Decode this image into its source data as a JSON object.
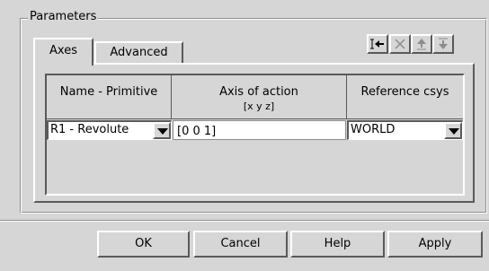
{
  "group": {
    "title": "Parameters"
  },
  "tabs": [
    {
      "label": "Axes",
      "active": true
    },
    {
      "label": "Advanced",
      "active": false
    }
  ],
  "toolbar": {
    "buttons": [
      {
        "icon": "insert-row-icon"
      },
      {
        "icon": "delete-x-icon"
      },
      {
        "icon": "move-up-icon"
      },
      {
        "icon": "move-down-icon"
      }
    ]
  },
  "table": {
    "columns": [
      {
        "line1": "",
        "line2": "Name - Primitive"
      },
      {
        "line1": "Axis of action",
        "line2": "[x y z]"
      },
      {
        "line1": "",
        "line2": "Reference csys"
      }
    ],
    "rows": [
      {
        "name": "R1 - Revolute",
        "axis": "[0 0 1]",
        "csys": "WORLD"
      }
    ]
  },
  "buttons": {
    "ok": "OK",
    "cancel": "Cancel",
    "help": "Help",
    "apply": "Apply"
  }
}
